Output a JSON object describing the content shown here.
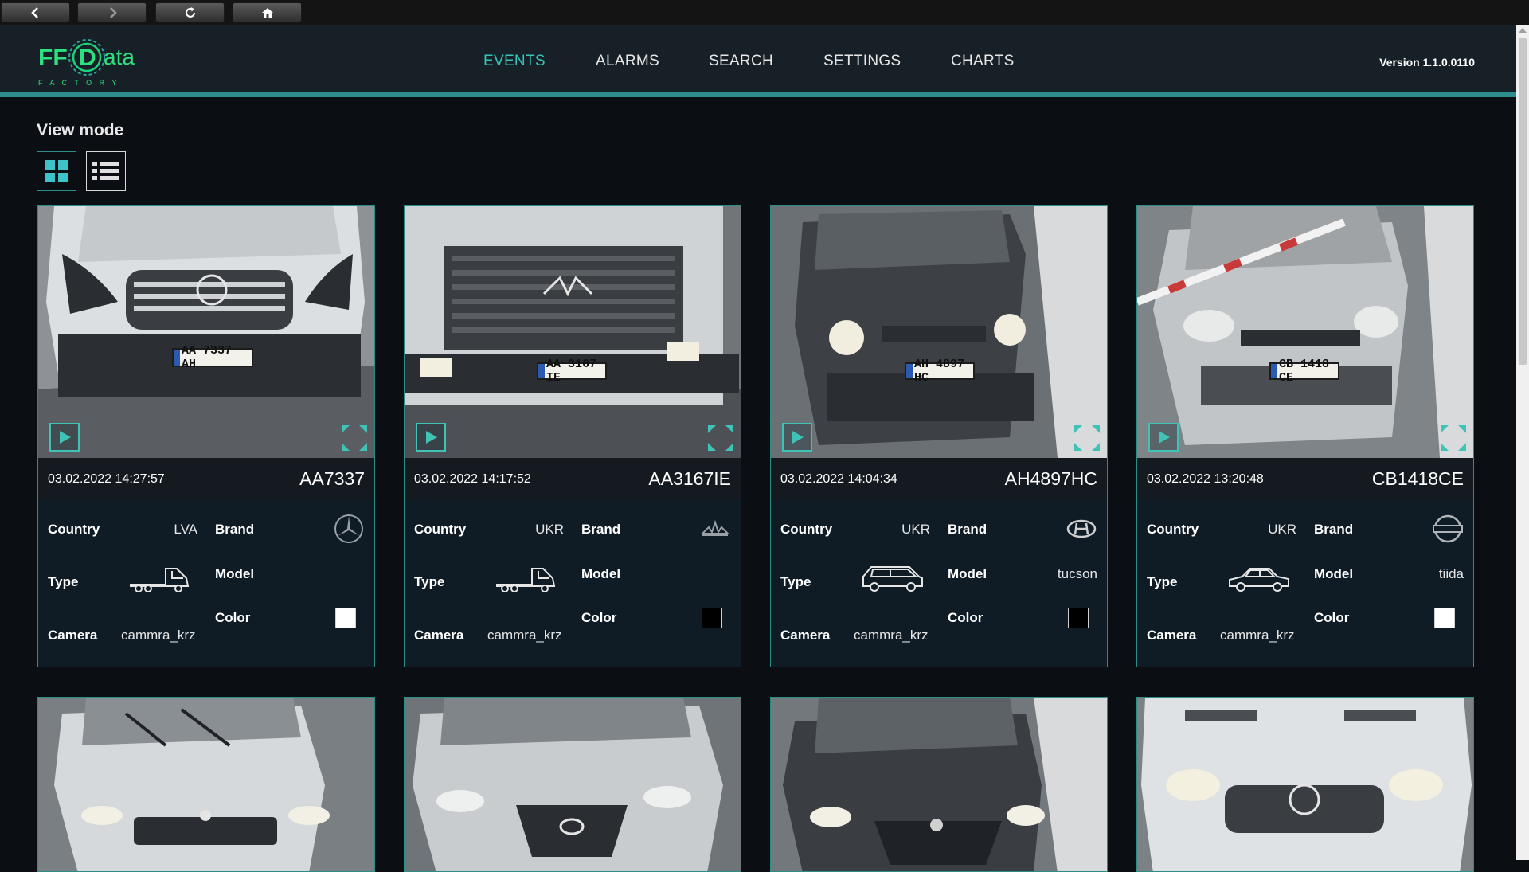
{
  "browser": {
    "buttons": [
      "back-icon",
      "forward-icon",
      "refresh-icon",
      "home-icon"
    ]
  },
  "header": {
    "logo_text_ff": "FF",
    "logo_text_d": "D",
    "logo_text_ata": "ata",
    "logo_sub": "F A C T O R Y",
    "nav": [
      "EVENTS",
      "ALARMS",
      "SEARCH",
      "SETTINGS",
      "CHARTS"
    ],
    "active_nav": "EVENTS",
    "version": "Version 1.1.0.0110"
  },
  "view_mode": {
    "label": "View mode",
    "options": [
      "grid-icon",
      "list-icon"
    ],
    "active": "grid-icon"
  },
  "labels": {
    "country": "Country",
    "brand": "Brand",
    "type": "Type",
    "model": "Model",
    "color": "Color",
    "camera": "Camera"
  },
  "events": [
    {
      "datetime": "03.02.2022 14:27:57",
      "plate": "AA7337",
      "plate_photo": "AA 7337 AH",
      "country": "LVA",
      "brand": "mercedes-logo-icon",
      "type": "truck-icon",
      "model": "",
      "color": "#ffffff",
      "camera": "cammra_krz"
    },
    {
      "datetime": "03.02.2022 14:17:52",
      "plate": "AA3167IE",
      "plate_photo": "AA 3167 IE",
      "country": "UKR",
      "brand": "maz-logo-icon",
      "type": "truck-icon",
      "model": "",
      "color": "#000000",
      "camera": "cammra_krz"
    },
    {
      "datetime": "03.02.2022 14:04:34",
      "plate": "AH4897HC",
      "plate_photo": "AH 4897 HC",
      "country": "UKR",
      "brand": "hyundai-logo-icon",
      "type": "suv-icon",
      "model": "tucson",
      "color": "#000000",
      "camera": "cammra_krz"
    },
    {
      "datetime": "03.02.2022 13:20:48",
      "plate": "CB1418CE",
      "plate_photo": "CB 1418 CE",
      "country": "UKR",
      "brand": "nissan-logo-icon",
      "type": "sedan-icon",
      "model": "tiida",
      "color": "#ffffff",
      "camera": "cammra_krz"
    }
  ],
  "colors": {
    "accent": "#2e8e8c",
    "accent_text": "#38c4b8",
    "header_bg": "#172027",
    "card_bg": "#0f1c26"
  }
}
